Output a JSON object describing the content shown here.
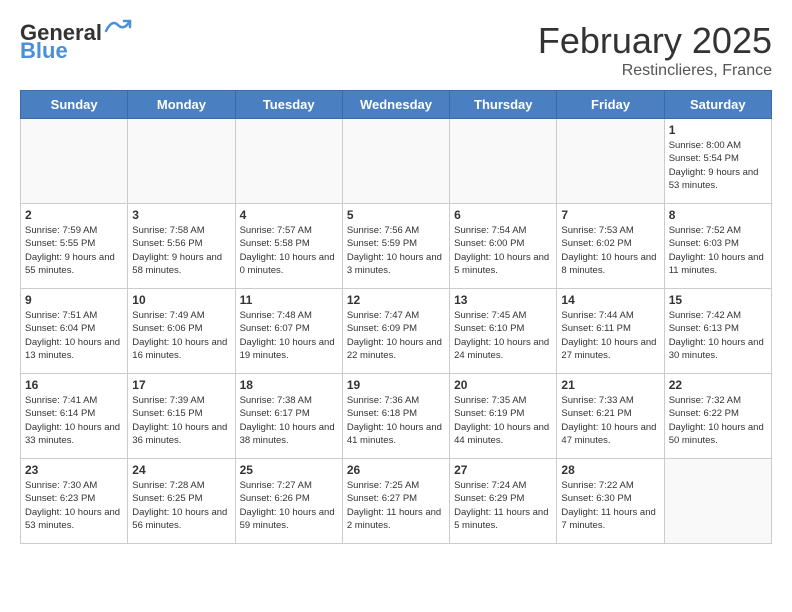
{
  "header": {
    "logo_general": "General",
    "logo_blue": "Blue",
    "month_title": "February 2025",
    "location": "Restinclieres, France"
  },
  "weekdays": [
    "Sunday",
    "Monday",
    "Tuesday",
    "Wednesday",
    "Thursday",
    "Friday",
    "Saturday"
  ],
  "weeks": [
    [
      {
        "day": "",
        "info": ""
      },
      {
        "day": "",
        "info": ""
      },
      {
        "day": "",
        "info": ""
      },
      {
        "day": "",
        "info": ""
      },
      {
        "day": "",
        "info": ""
      },
      {
        "day": "",
        "info": ""
      },
      {
        "day": "1",
        "info": "Sunrise: 8:00 AM\nSunset: 5:54 PM\nDaylight: 9 hours and 53 minutes."
      }
    ],
    [
      {
        "day": "2",
        "info": "Sunrise: 7:59 AM\nSunset: 5:55 PM\nDaylight: 9 hours and 55 minutes."
      },
      {
        "day": "3",
        "info": "Sunrise: 7:58 AM\nSunset: 5:56 PM\nDaylight: 9 hours and 58 minutes."
      },
      {
        "day": "4",
        "info": "Sunrise: 7:57 AM\nSunset: 5:58 PM\nDaylight: 10 hours and 0 minutes."
      },
      {
        "day": "5",
        "info": "Sunrise: 7:56 AM\nSunset: 5:59 PM\nDaylight: 10 hours and 3 minutes."
      },
      {
        "day": "6",
        "info": "Sunrise: 7:54 AM\nSunset: 6:00 PM\nDaylight: 10 hours and 5 minutes."
      },
      {
        "day": "7",
        "info": "Sunrise: 7:53 AM\nSunset: 6:02 PM\nDaylight: 10 hours and 8 minutes."
      },
      {
        "day": "8",
        "info": "Sunrise: 7:52 AM\nSunset: 6:03 PM\nDaylight: 10 hours and 11 minutes."
      }
    ],
    [
      {
        "day": "9",
        "info": "Sunrise: 7:51 AM\nSunset: 6:04 PM\nDaylight: 10 hours and 13 minutes."
      },
      {
        "day": "10",
        "info": "Sunrise: 7:49 AM\nSunset: 6:06 PM\nDaylight: 10 hours and 16 minutes."
      },
      {
        "day": "11",
        "info": "Sunrise: 7:48 AM\nSunset: 6:07 PM\nDaylight: 10 hours and 19 minutes."
      },
      {
        "day": "12",
        "info": "Sunrise: 7:47 AM\nSunset: 6:09 PM\nDaylight: 10 hours and 22 minutes."
      },
      {
        "day": "13",
        "info": "Sunrise: 7:45 AM\nSunset: 6:10 PM\nDaylight: 10 hours and 24 minutes."
      },
      {
        "day": "14",
        "info": "Sunrise: 7:44 AM\nSunset: 6:11 PM\nDaylight: 10 hours and 27 minutes."
      },
      {
        "day": "15",
        "info": "Sunrise: 7:42 AM\nSunset: 6:13 PM\nDaylight: 10 hours and 30 minutes."
      }
    ],
    [
      {
        "day": "16",
        "info": "Sunrise: 7:41 AM\nSunset: 6:14 PM\nDaylight: 10 hours and 33 minutes."
      },
      {
        "day": "17",
        "info": "Sunrise: 7:39 AM\nSunset: 6:15 PM\nDaylight: 10 hours and 36 minutes."
      },
      {
        "day": "18",
        "info": "Sunrise: 7:38 AM\nSunset: 6:17 PM\nDaylight: 10 hours and 38 minutes."
      },
      {
        "day": "19",
        "info": "Sunrise: 7:36 AM\nSunset: 6:18 PM\nDaylight: 10 hours and 41 minutes."
      },
      {
        "day": "20",
        "info": "Sunrise: 7:35 AM\nSunset: 6:19 PM\nDaylight: 10 hours and 44 minutes."
      },
      {
        "day": "21",
        "info": "Sunrise: 7:33 AM\nSunset: 6:21 PM\nDaylight: 10 hours and 47 minutes."
      },
      {
        "day": "22",
        "info": "Sunrise: 7:32 AM\nSunset: 6:22 PM\nDaylight: 10 hours and 50 minutes."
      }
    ],
    [
      {
        "day": "23",
        "info": "Sunrise: 7:30 AM\nSunset: 6:23 PM\nDaylight: 10 hours and 53 minutes."
      },
      {
        "day": "24",
        "info": "Sunrise: 7:28 AM\nSunset: 6:25 PM\nDaylight: 10 hours and 56 minutes."
      },
      {
        "day": "25",
        "info": "Sunrise: 7:27 AM\nSunset: 6:26 PM\nDaylight: 10 hours and 59 minutes."
      },
      {
        "day": "26",
        "info": "Sunrise: 7:25 AM\nSunset: 6:27 PM\nDaylight: 11 hours and 2 minutes."
      },
      {
        "day": "27",
        "info": "Sunrise: 7:24 AM\nSunset: 6:29 PM\nDaylight: 11 hours and 5 minutes."
      },
      {
        "day": "28",
        "info": "Sunrise: 7:22 AM\nSunset: 6:30 PM\nDaylight: 11 hours and 7 minutes."
      },
      {
        "day": "",
        "info": ""
      }
    ]
  ]
}
